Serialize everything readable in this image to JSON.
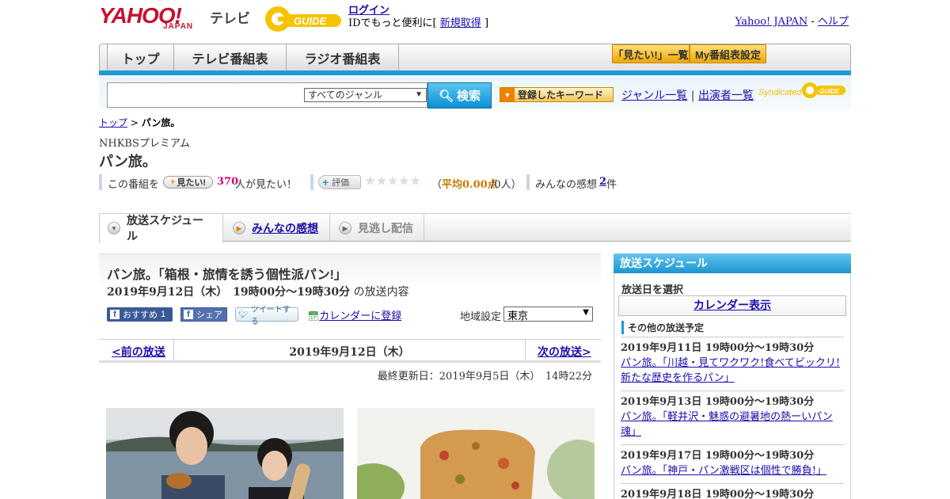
{
  "header": {
    "yahoo_logo": "YAHOO!",
    "japan_logo": "JAPAN",
    "tv_label": "テレビ",
    "gguide_logo": "GUIDE",
    "login_label": "ログイン",
    "id_prefix": "IDでもっと便利に[",
    "signup_label": "新規取得",
    "id_suffix": "]",
    "yahoo_japan_link": "Yahoo! JAPAN",
    "separator": "-",
    "help_link": "ヘルプ"
  },
  "nav": {
    "tabs": [
      {
        "label": "トップ"
      },
      {
        "label": "テレビ番組表"
      },
      {
        "label": "ラジオ番組表"
      }
    ],
    "mitai_list": "「見たい!」一覧",
    "my_schedule": "My番組表設定"
  },
  "search": {
    "placeholder": "",
    "genre_value": "すべてのジャンル",
    "button_label": "検索",
    "keyword_button": "登録したキーワード",
    "genre_list_link": "ジャンル一覧",
    "divider": "|",
    "performers_link": "出演者一覧",
    "syndicated": "Syndicated"
  },
  "breadcrumb": {
    "top": "トップ",
    "sep": ">",
    "current": "パン旅。"
  },
  "program": {
    "channel": "NHKBSプレミアム",
    "title": "パン旅。",
    "stats_prefix": "この番組を",
    "mitai_chip": "見たい!",
    "mitai_count": "370",
    "mitai_suffix": "人が見たい！",
    "hyoka_chip": "評価",
    "stars": "★★★★★",
    "rating_open": "（",
    "rating_avg": "平均0.00点",
    "rating_count": "/0人）",
    "impressions_label": "みんなの感想",
    "impressions_count": "2",
    "impressions_unit": "件"
  },
  "subtabs": {
    "schedule": "放送スケジュール",
    "impressions": "みんなの感想",
    "missed": "見逃し配信"
  },
  "episode": {
    "title": "パン旅。「箱根・旅情を誘う個性派パン!」",
    "time": "2019年9月12日（木）　19時00分～19時30分",
    "time_suffix": "の放送内容",
    "fb_recommend": "おすすめ",
    "fb_count": "1",
    "fb_share": "シェア",
    "tweet": "ツイートする",
    "calendar_link": "カレンダーに登録",
    "region_label": "地域設定",
    "region_value": "東京",
    "prev": "<前の放送",
    "current_date": "2019年9月12日（木）",
    "next": "次の放送>",
    "updated": "最終更新日：2019年9月5日（木）　14時22分"
  },
  "sidebar": {
    "heading": "放送スケジュール",
    "select_date": "放送日を選択",
    "calendar_display": "カレンダー表示",
    "other_heading": "その他の放送予定",
    "schedules": [
      {
        "date": "2019年9月11日 19時00分～19時30分",
        "title": "パン旅。「川越・見てワクワク!食べてビックリ!新たな歴史を作るパン」"
      },
      {
        "date": "2019年9月13日 19時00分～19時30分",
        "title": "パン旅。「軽井沢・魅惑の避暑地の熱ーいパン魂」"
      },
      {
        "date": "2019年9月17日 19時00分～19時30分",
        "title": "パン旅。「神戸・パン激戦区は個性で勝負!」"
      },
      {
        "date": "2019年9月18日 19時00分～19時30分",
        "title": ""
      }
    ]
  },
  "colors": {
    "accent_blue": "#1e9ad6",
    "yahoo_red": "#c8102e",
    "link": "#1a0dab",
    "count_pink": "#d6006f",
    "rating_orange": "#c87800"
  }
}
